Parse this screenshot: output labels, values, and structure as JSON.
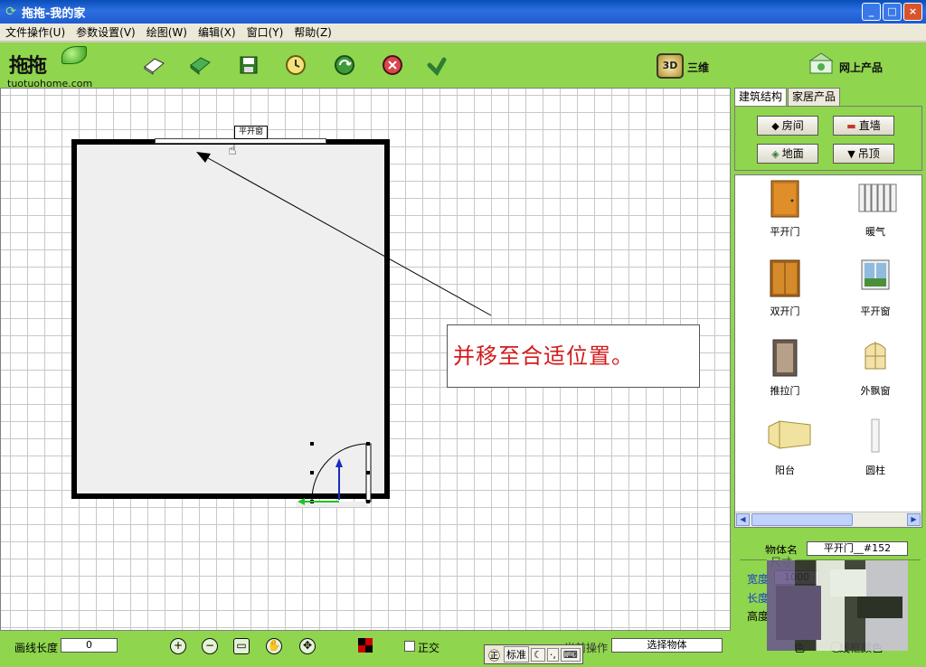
{
  "window": {
    "title": "拖拖-我的家",
    "controls": [
      "_",
      "□",
      "×"
    ]
  },
  "menu": [
    "文件操作(U)",
    "参数设置(V)",
    "绘图(W)",
    "编辑(X)",
    "窗口(Y)",
    "帮助(Z)"
  ],
  "toolbar": {
    "logo_text": "拖拖",
    "domain": "tuotuohome.com",
    "buttons": [
      "new-icon",
      "open-icon",
      "save-icon",
      "clock-icon",
      "refresh-icon",
      "stop-icon",
      "undo-icon"
    ],
    "three_d_badge": "3D",
    "three_d_label": "三维",
    "online_label": "网上产品"
  },
  "canvas": {
    "tooltip": "平开窗",
    "callout": "并移至合适位置。"
  },
  "panel": {
    "tabs": [
      "建筑结构",
      "家居产品"
    ],
    "categories": [
      {
        "label": "房间",
        "icon": "room-icon"
      },
      {
        "label": "直墙",
        "icon": "wall-icon"
      },
      {
        "label": "地面",
        "icon": "floor-icon"
      },
      {
        "label": "吊顶",
        "icon": "ceiling-icon"
      }
    ],
    "items": [
      {
        "label": "平开门",
        "icon": "swing-door-icon"
      },
      {
        "label": "暖气",
        "icon": "radiator-icon"
      },
      {
        "label": "双开门",
        "icon": "double-door-icon"
      },
      {
        "label": "平开窗",
        "icon": "casement-window-icon"
      },
      {
        "label": "推拉门",
        "icon": "sliding-door-icon"
      },
      {
        "label": "外飘窗",
        "icon": "bay-window-icon"
      },
      {
        "label": "阳台",
        "icon": "balcony-icon"
      },
      {
        "label": "圆柱",
        "icon": "column-icon"
      }
    ]
  },
  "properties": {
    "object_name_label": "物体名",
    "object_name": "平开门__#152",
    "size_label": "尺寸",
    "width_label": "宽度",
    "width": "1000",
    "length_label": "长度",
    "height_label": "高度",
    "frame_color_label": "线框颜色",
    "color_partial": "色"
  },
  "status": {
    "line_length_label": "画线长度",
    "line_length": "0",
    "ortho_label": "正交",
    "op_label": "当前操作",
    "op_value": "选择物体",
    "ime": [
      "标准",
      "·,"
    ]
  }
}
